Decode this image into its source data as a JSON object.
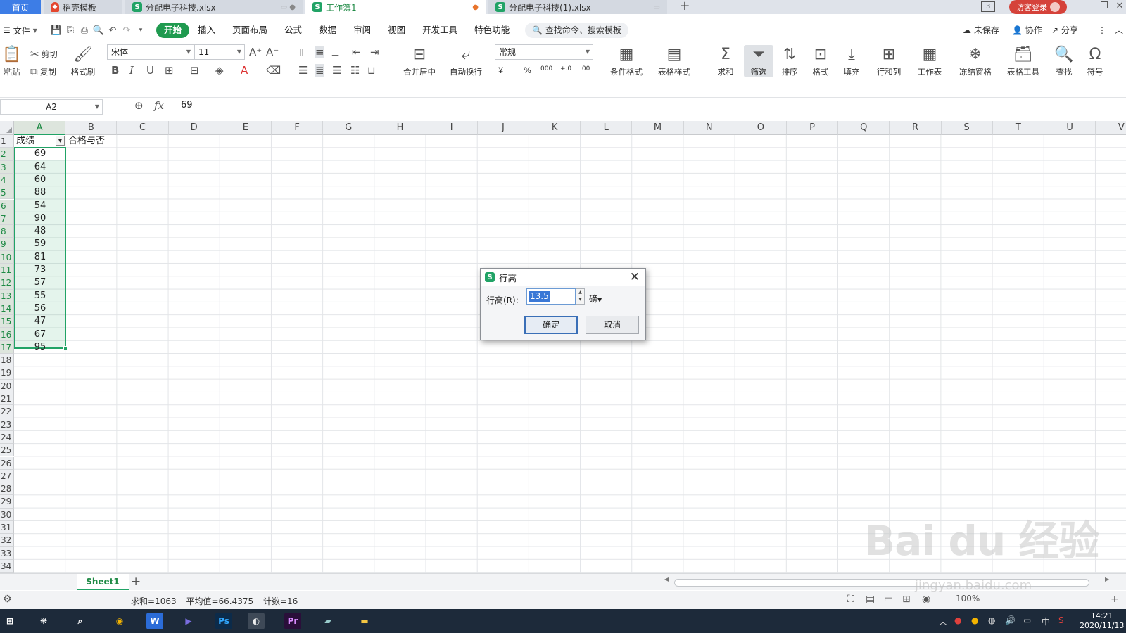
{
  "tabs": {
    "home": "首页",
    "t1": "稻壳模板",
    "t2": "分配电子科技.xlsx",
    "t3": "工作簿1",
    "t4": "分配电子科技(1).xlsx",
    "count_badge": "3",
    "login": "访客登录"
  },
  "menu": {
    "file": "文件",
    "items": [
      "开始",
      "插入",
      "页面布局",
      "公式",
      "数据",
      "审阅",
      "视图",
      "开发工具",
      "特色功能"
    ],
    "search": "查找命令、搜索模板",
    "unsaved": "未保存",
    "collab": "协作",
    "share": "分享"
  },
  "ribbon": {
    "paste": "粘贴",
    "cut": "剪切",
    "copy": "复制",
    "format_painter": "格式刷",
    "font_name": "宋体",
    "font_size": "11",
    "merge_center": "合并居中",
    "wrap_text": "自动换行",
    "number_format": "常规",
    "currency": "¥",
    "percent": "%",
    "thousands": "000",
    "dec_inc": "+.0",
    "dec_dec": ".00",
    "cond_format": "条件格式",
    "table_style": "表格样式",
    "sum": "求和",
    "filter": "筛选",
    "sort": "排序",
    "format": "格式",
    "fill": "填充",
    "row_col": "行和列",
    "worksheet": "工作表",
    "freeze": "冻结窗格",
    "table_tools": "表格工具",
    "find": "查找",
    "symbol": "符号"
  },
  "formula_bar": {
    "name_box": "A2",
    "fx": "fx",
    "value": "69"
  },
  "columns": [
    "A",
    "B",
    "C",
    "D",
    "E",
    "F",
    "G",
    "H",
    "I",
    "J",
    "K",
    "L",
    "M",
    "N",
    "O",
    "P",
    "Q",
    "R",
    "S",
    "T",
    "U",
    "V"
  ],
  "rows": [
    "1",
    "2",
    "3",
    "4",
    "5",
    "6",
    "7",
    "8",
    "9",
    "10",
    "11",
    "12",
    "13",
    "14",
    "15",
    "16",
    "17",
    "18",
    "19",
    "20",
    "21",
    "22",
    "23",
    "24",
    "25",
    "26",
    "27",
    "28",
    "29",
    "30",
    "31",
    "32",
    "33",
    "34"
  ],
  "sheet": {
    "header_a": "成绩",
    "header_b": "合格与否",
    "scores": [
      "69",
      "64",
      "60",
      "88",
      "54",
      "90",
      "48",
      "59",
      "81",
      "73",
      "57",
      "55",
      "56",
      "47",
      "67",
      "95"
    ]
  },
  "dialog": {
    "title": "行高",
    "label": "行高(R):",
    "value": "13.5",
    "unit": "磅",
    "ok": "确定",
    "cancel": "取消"
  },
  "sheetbar": {
    "tab": "Sheet1",
    "add": "+"
  },
  "status": {
    "sum": "求和=1063",
    "avg": "平均值=66.4375",
    "count": "计数=16",
    "zoom": "100%"
  },
  "taskbar": {
    "time": "14:21",
    "date": "2020/11/13",
    "ime": "中"
  },
  "watermark": {
    "brand": "Bai du 经验",
    "url": "jingyan.baidu.com"
  },
  "colors": {
    "accent": "#21a366",
    "active_tab": "#1f9a4f",
    "home_tab": "#3d7de6",
    "login": "#d5423a"
  }
}
